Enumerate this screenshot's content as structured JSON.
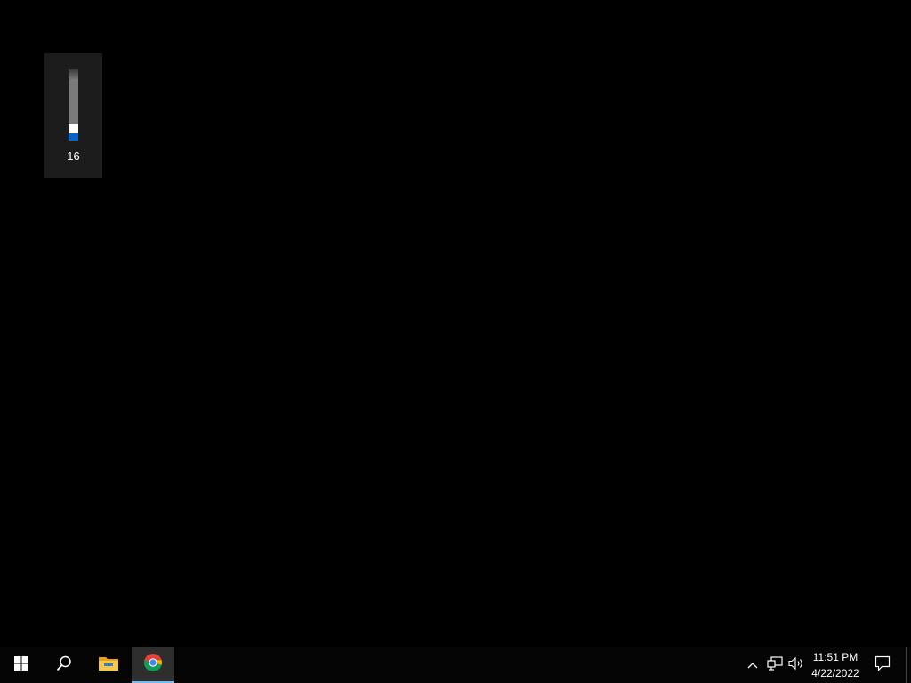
{
  "volume_flyout": {
    "level": "16",
    "level_fraction": 0.16
  },
  "taskbar": {
    "icons": {
      "start": "windows-start-icon",
      "search": "search-icon",
      "file_explorer": "file-explorer-icon",
      "chrome": "chrome-icon",
      "tray_overflow": "chevron-up-icon",
      "network": "network-icon",
      "volume": "speaker-icon",
      "notifications": "action-center-icon"
    },
    "clock": {
      "time": "11:51 PM",
      "date": "4/22/2022"
    }
  },
  "colors": {
    "accent": "#0a63c9",
    "active_underline": "#76b9ed",
    "desktop_bg": "#000000"
  }
}
